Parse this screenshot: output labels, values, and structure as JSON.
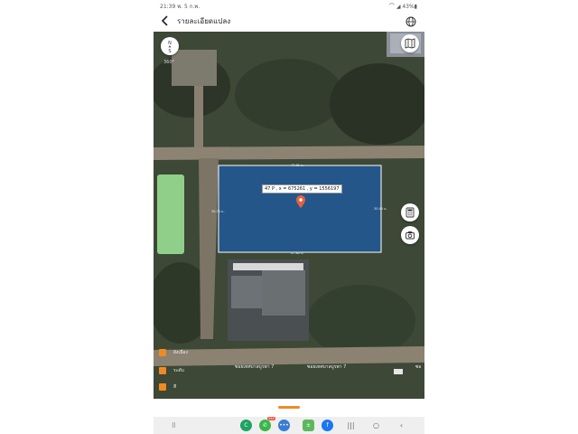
{
  "status_bar": {
    "time_date": "21:39  พ. 5 ก.พ.",
    "right": "⌒ ◢ 43%▮"
  },
  "app_bar": {
    "title": "รายละเอียดแปลง",
    "back_icon": "chevron-left-icon",
    "globe_icon": "globe-icon"
  },
  "map": {
    "compass_label": "360°",
    "compass_letters": "N\nS",
    "plot_label": "47 P , x = 675261 , y = 1556197",
    "dimensions": {
      "top": "47.81 ม.",
      "left": "36.74 ม.",
      "right": "30.04 ม.",
      "bottom": "47.80 ม."
    },
    "road_labels": [
      "ซอยเทศบาลบูรพา 7",
      "ซอยเทศบาลบูรพา 7",
      "ซอ"
    ],
    "legend": [
      {
        "color": "#f08a24",
        "label": "ผังเมือง"
      },
      {
        "color": "#f08a24",
        "label": "ระดับ"
      },
      {
        "color": "#f08a24",
        "label": "สี"
      }
    ],
    "buttons": {
      "map_layers": "map-layers-icon",
      "calculator": "calculator-icon",
      "camera": "camera-icon"
    },
    "colors": {
      "plot_fill": "#1f5aa0",
      "plot_border": "#ffffff",
      "pin": "#e8603c",
      "green_field": "#8fcf8a"
    }
  },
  "nav_bar": {
    "badge": "264",
    "apps": [
      "line",
      "phone",
      "messages",
      "calculator",
      "facebook"
    ],
    "controls": [
      "recent-apps",
      "home",
      "back"
    ]
  }
}
